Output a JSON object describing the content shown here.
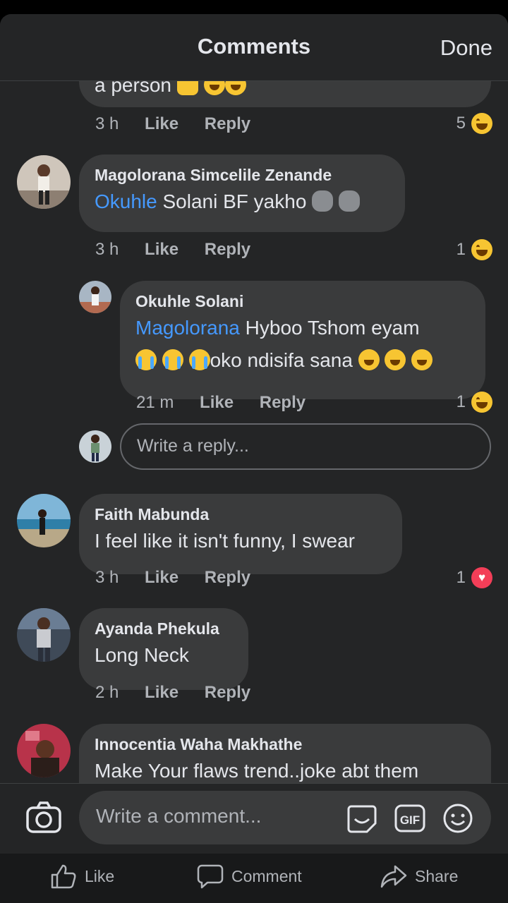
{
  "header": {
    "title": "Comments",
    "done_label": "Done"
  },
  "comments": [
    {
      "text_tail": "a person",
      "time": "3 h",
      "like": "Like",
      "reply": "Reply",
      "reaction_count": "5",
      "reaction": "haha"
    },
    {
      "author": "Magolorana Simcelile Zenande",
      "mention": "Okuhle",
      "text": " Solani BF yakho",
      "time": "3 h",
      "like": "Like",
      "reply": "Reply",
      "reaction_count": "1",
      "reaction": "haha",
      "replies": [
        {
          "author": "Okuhle Solani",
          "mention": "Magolorana",
          "text_line1": " Hyboo Tshom eyam",
          "text_line2": "oko ndisifa sana",
          "time": "21 m",
          "like": "Like",
          "reply": "Reply",
          "reaction_count": "1",
          "reaction": "haha"
        }
      ],
      "reply_placeholder": "Write a reply..."
    },
    {
      "author": "Faith Mabunda",
      "text": "I feel like it isn't funny, I swear",
      "time": "3 h",
      "like": "Like",
      "reply": "Reply",
      "reaction_count": "1",
      "reaction": "love"
    },
    {
      "author": "Ayanda Phekula",
      "text": "Long Neck",
      "time": "2 h",
      "like": "Like",
      "reply": "Reply"
    },
    {
      "author": "Innocentia Waha Makhathe",
      "text": "Make Your flaws trend..joke abt them"
    }
  ],
  "composer": {
    "placeholder": "Write a comment..."
  },
  "tabbar": {
    "like": "Like",
    "comment": "Comment",
    "share": "Share"
  },
  "colors": {
    "background": "#242526",
    "bubble": "#3a3b3c",
    "mention": "#4599ff",
    "love": "#f33e58",
    "haha": "#f7c532"
  }
}
